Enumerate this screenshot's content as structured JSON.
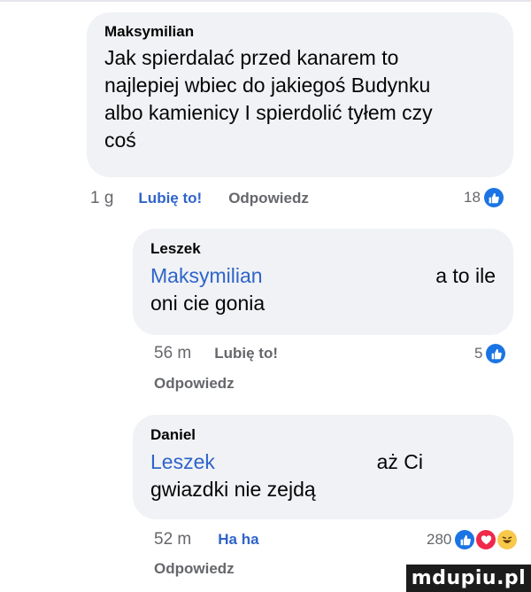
{
  "comments": [
    {
      "author": "Maksymilian",
      "lines": [
        "Jak spierdalać przed kanarem to",
        "najlepiej wbiec do jakiegoś Budynku",
        "albo kamienicy I spierdolić tyłem czy",
        "coś"
      ],
      "time": "1 g",
      "like_label": "Lubię to!",
      "reply_label": "Odpowiedz",
      "reaction_count": "18",
      "reactions": [
        "like-icon"
      ]
    },
    {
      "author": "Leszek",
      "mention": "Maksymilian",
      "text_right": "a to ile",
      "text_line2": "oni cie gonia",
      "time": "56 m",
      "like_label": "Lubię to!",
      "reply_label": "Odpowiedz",
      "reaction_count": "5",
      "reactions": [
        "like-icon"
      ]
    },
    {
      "author": "Daniel",
      "mention": "Leszek",
      "text_right": "aż Ci",
      "text_line2": "gwiazdki nie zejdą",
      "time": "52 m",
      "like_label": "Ha ha",
      "reply_label": "Odpowiedz",
      "reaction_count": "280",
      "reactions": [
        "like-icon",
        "love-icon",
        "haha-icon"
      ]
    }
  ],
  "watermark": "mdupiu.pl",
  "colors": {
    "bubble": "#f0f2f5",
    "mention": "#2f64c9",
    "meta": "#65676b",
    "like": "#1b74e4",
    "love": "#f0284a",
    "haha": "#f7c84a"
  }
}
